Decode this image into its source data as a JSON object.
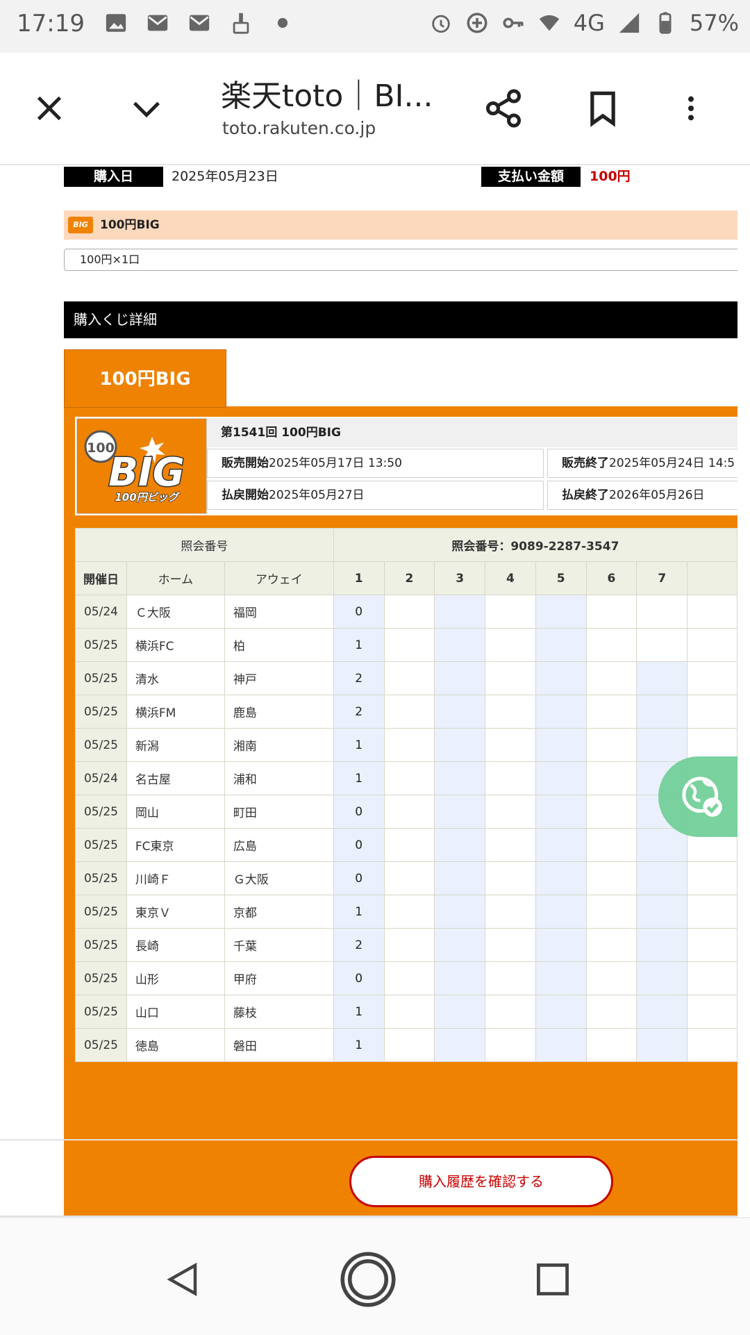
{
  "status_bar": {
    "time": "17:19",
    "network": "4G",
    "battery": "57%"
  },
  "toolbar": {
    "title": "楽天toto｜BI...",
    "url": "toto.rakuten.co.jp"
  },
  "purchase": {
    "date_label": "購入日",
    "date_value": "2025年05月23日",
    "amount_label": "支払い金額",
    "amount_value": "100円",
    "product_name": "100円BIG",
    "product_icon_text": "BIG",
    "units": "100円×1口"
  },
  "details_header": "購入くじ詳細",
  "tab_label": "100円BIG",
  "lottery": {
    "round": "第1541回 100円BIG",
    "logo_100": "100",
    "logo_big": "BIG",
    "logo_sub": "100円ビッグ",
    "sale_start_label": "販売開始",
    "sale_start": "2025年05月17日 13:50",
    "sale_end_label": "販売終了",
    "sale_end": "2025年05月24日 14:5",
    "payout_start_label": "払戻開始",
    "payout_start": "2025年05月27日",
    "payout_end_label": "払戻終了",
    "payout_end": "2026年05月26日"
  },
  "grid": {
    "ref_label": "照会番号",
    "ref_number": "照会番号：9089-2287-3547",
    "col_date": "開催日",
    "col_home": "ホーム",
    "col_away": "アウェイ",
    "col_numbers": [
      "1",
      "2",
      "3",
      "4",
      "5",
      "6",
      "7"
    ],
    "rows": [
      {
        "date": "05/24",
        "home": "Ｃ大阪",
        "away": "福岡",
        "pick": "0"
      },
      {
        "date": "05/25",
        "home": "横浜FC",
        "away": "柏",
        "pick": "1"
      },
      {
        "date": "05/25",
        "home": "清水",
        "away": "神戸",
        "pick": "2"
      },
      {
        "date": "05/25",
        "home": "横浜FM",
        "away": "鹿島",
        "pick": "2"
      },
      {
        "date": "05/25",
        "home": "新潟",
        "away": "湘南",
        "pick": "1"
      },
      {
        "date": "05/24",
        "home": "名古屋",
        "away": "浦和",
        "pick": "1"
      },
      {
        "date": "05/25",
        "home": "岡山",
        "away": "町田",
        "pick": "0"
      },
      {
        "date": "05/25",
        "home": "FC東京",
        "away": "広島",
        "pick": "0"
      },
      {
        "date": "05/25",
        "home": "川崎Ｆ",
        "away": "Ｇ大阪",
        "pick": "0"
      },
      {
        "date": "05/25",
        "home": "東京Ｖ",
        "away": "京都",
        "pick": "1"
      },
      {
        "date": "05/25",
        "home": "長崎",
        "away": "千葉",
        "pick": "2"
      },
      {
        "date": "05/25",
        "home": "山形",
        "away": "甲府",
        "pick": "0"
      },
      {
        "date": "05/25",
        "home": "山口",
        "away": "藤枝",
        "pick": "1"
      },
      {
        "date": "05/25",
        "home": "徳島",
        "away": "磐田",
        "pick": "1"
      }
    ]
  },
  "orange_bottom_text": "購",
  "history_button": "購入履歴を確認する",
  "colors": {
    "orange": "#ef8200",
    "red": "#c70000",
    "blue_cell": "#eaf1fd"
  }
}
